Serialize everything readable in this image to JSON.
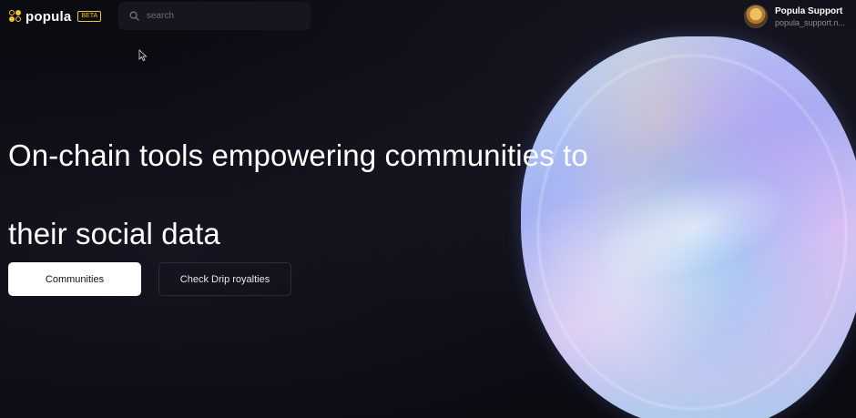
{
  "header": {
    "logo_text": "popula",
    "beta_badge": "BETA",
    "search_placeholder": "search",
    "user": {
      "name": "Popula Support",
      "handle": "popula_support.n..."
    }
  },
  "hero": {
    "title": "On-chain tools empowering communities to their social data",
    "primary_button": "Communities",
    "secondary_button": "Check Drip royalties"
  },
  "colors": {
    "background": "#0b0b12",
    "brand_accent": "#f2c230",
    "primary_button_bg": "#ffffff"
  }
}
